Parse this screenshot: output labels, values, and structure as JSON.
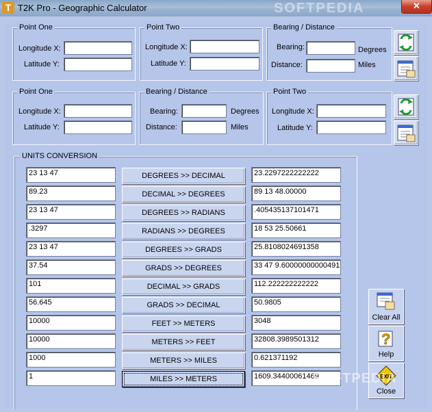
{
  "window": {
    "title": "T2K Pro - Geographic Calculator",
    "app_icon": "T",
    "close": "✕",
    "watermark": "SOFTPEDIA"
  },
  "panel1": {
    "point_one": {
      "legend": "Point One",
      "longitude_label": "Longitude X:",
      "latitude_label": "Latitude Y:",
      "longitude_value": "",
      "latitude_value": ""
    },
    "point_two": {
      "legend": "Point Two",
      "longitude_label": "Longitude X:",
      "latitude_label": "Latitude Y:",
      "longitude_value": "",
      "latitude_value": ""
    },
    "bearing_distance": {
      "legend": "Bearing / Distance",
      "bearing_label": "Bearing:",
      "distance_label": "Distance:",
      "bearing_unit": "Degrees",
      "distance_unit": "Miles",
      "bearing_value": "",
      "distance_value": ""
    }
  },
  "panel2": {
    "point_one": {
      "legend": "Point One",
      "longitude_label": "Longitude X:",
      "latitude_label": "Latitude Y:",
      "longitude_value": "",
      "latitude_value": ""
    },
    "bearing_distance": {
      "legend": "Bearing / Distance",
      "bearing_label": "Bearing:",
      "distance_label": "Distance:",
      "bearing_unit": "Degrees",
      "distance_unit": "Miles",
      "bearing_value": "",
      "distance_value": ""
    },
    "point_two": {
      "legend": "Point Two",
      "longitude_label": "Longitude X:",
      "latitude_label": "Latitude Y:",
      "longitude_value": "",
      "latitude_value": ""
    }
  },
  "units": {
    "legend": "UNITS CONVERSION",
    "rows": [
      {
        "input": "23 13 47",
        "button": "DEGREES >> DECIMAL",
        "output": "23.2297222222222"
      },
      {
        "input": "89.23",
        "button": "DECIMAL >> DEGREES",
        "output": "89 13 48.00000"
      },
      {
        "input": "23 13 47",
        "button": "DEGREES >> RADIANS",
        "output": ".405435137101471"
      },
      {
        "input": ".3297",
        "button": "RADIANS >> DEGREES",
        "output": "18 53 25.50661"
      },
      {
        "input": "23 13 47",
        "button": "DEGREES >> GRADS",
        "output": "25.8108024691358"
      },
      {
        "input": "37.54",
        "button": "GRADS >> DEGREES",
        "output": "33 47 9.60000000000491"
      },
      {
        "input": "101",
        "button": "DECIMAL >> GRADS",
        "output": "112.222222222222"
      },
      {
        "input": "56.645",
        "button": "GRADS >> DECIMAL",
        "output": "50.9805"
      },
      {
        "input": "10000",
        "button": "FEET >> METERS",
        "output": "3048"
      },
      {
        "input": "10000",
        "button": "METERS >> FEET",
        "output": "32808.3989501312"
      },
      {
        "input": "1000",
        "button": "METERS >> MILES",
        "output": "0.621371192"
      },
      {
        "input": "1",
        "button": "MILES >> METERS",
        "output": "1609.34400061469"
      }
    ]
  },
  "side_buttons": {
    "clear_all": "Clear All",
    "help": "Help",
    "close": "Close",
    "exit_sign": "EXIT"
  },
  "icons": [
    "calculate-icon",
    "clear-form-icon",
    "clear-all-icon",
    "help-icon",
    "exit-icon"
  ]
}
